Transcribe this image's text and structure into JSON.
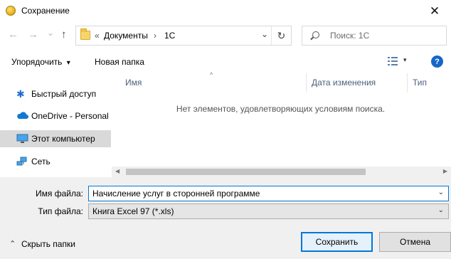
{
  "window": {
    "title": "Сохранение",
    "close_glyph": "✕"
  },
  "nav": {
    "back_glyph": "←",
    "forward_glyph": "→",
    "dropdown_glyph": "⌄",
    "up_glyph": "↑"
  },
  "address": {
    "overflow": "«",
    "segments": [
      "Документы",
      "1С"
    ],
    "separator": "›",
    "chevron_glyph": "⌄",
    "refresh_glyph": "↻"
  },
  "search": {
    "placeholder": "Поиск: 1С"
  },
  "toolbar": {
    "organize_label": "Упорядочить",
    "organize_caret": "▾",
    "new_folder_label": "Новая папка",
    "view_caret": "▾",
    "help_label": "?"
  },
  "sidebar": {
    "items": [
      {
        "label": "Быстрый доступ",
        "icon": "star-icon",
        "selected": false
      },
      {
        "label": "OneDrive - Personal",
        "icon": "cloud-icon",
        "selected": false
      },
      {
        "label": "Этот компьютер",
        "icon": "computer-icon",
        "selected": true
      },
      {
        "label": "Сеть",
        "icon": "network-icon",
        "selected": false
      }
    ]
  },
  "content": {
    "columns": [
      "Имя",
      "Дата изменения",
      "Тип"
    ],
    "sort_glyph": "^",
    "empty_message": "Нет элементов, удовлетворяющих условиям поиска."
  },
  "form": {
    "filename_label": "Имя файла:",
    "filename_value": "Начисление услуг в сторонней программе",
    "filetype_label": "Тип файла:",
    "filetype_value": "Книга Excel 97 (*.xls)",
    "caret_glyph": "⌄"
  },
  "footer": {
    "hide_folders_glyph": "⌃",
    "hide_folders_label": "Скрыть папки",
    "save_label": "Сохранить",
    "cancel_label": "Отмена"
  },
  "colors": {
    "accent": "#0078d7",
    "selection": "#d9d9d9",
    "help_blue": "#1666c9"
  }
}
